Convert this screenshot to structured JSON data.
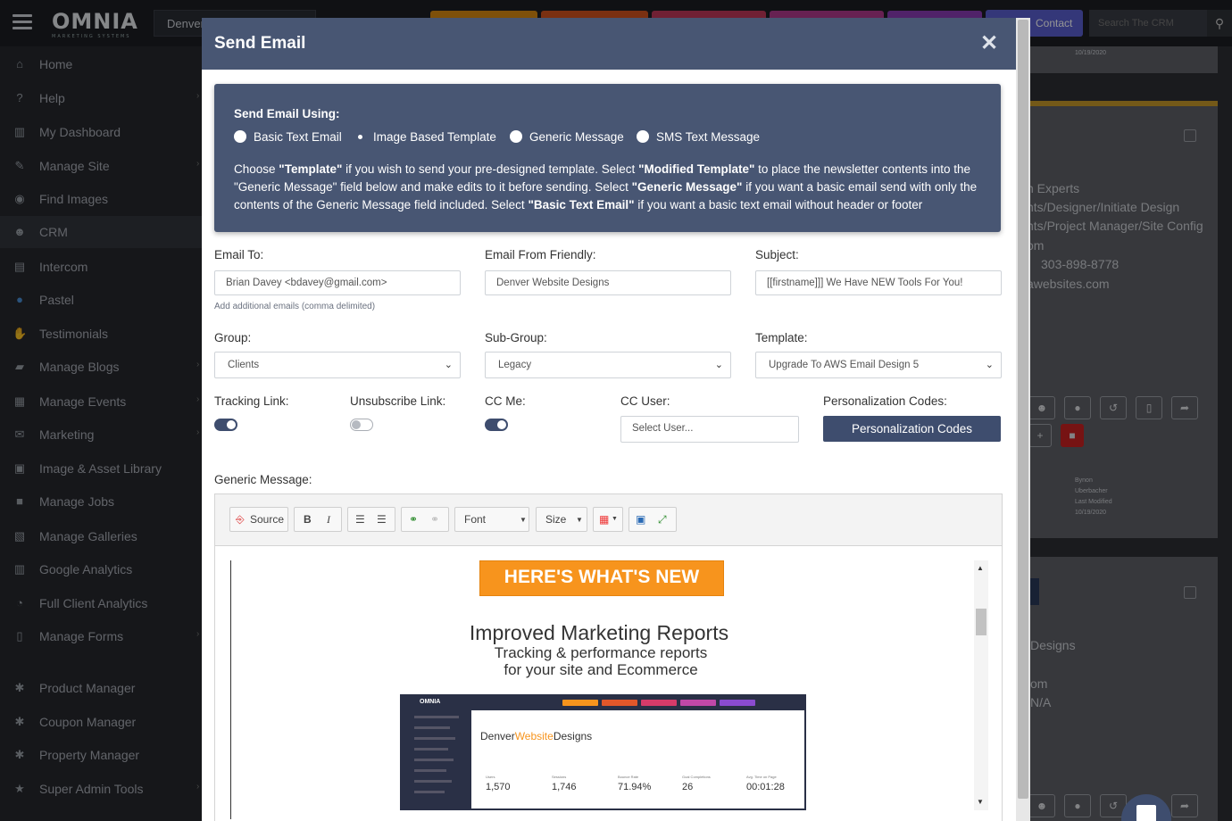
{
  "app": {
    "logo": "OMNIA",
    "logo_sub": "MARKETING SYSTEMS",
    "site_selector": "Denver",
    "contact_label": "Contact",
    "search_placeholder": "Search The CRM"
  },
  "sidebar": {
    "items": [
      {
        "label": "Home",
        "icon": "home-icon"
      },
      {
        "label": "Help",
        "icon": "question-icon"
      },
      {
        "label": "My Dashboard",
        "icon": "bar-chart-icon"
      },
      {
        "label": "Manage Site",
        "icon": "wrench-icon"
      },
      {
        "label": "Find Images",
        "icon": "camera-icon"
      },
      {
        "label": "CRM",
        "icon": "users-icon"
      },
      {
        "label": "Intercom",
        "icon": "chat-icon"
      },
      {
        "label": "Pastel",
        "icon": "brush-icon"
      },
      {
        "label": "Testimonials",
        "icon": "handshake-icon"
      },
      {
        "label": "Manage Blogs",
        "icon": "comments-icon"
      },
      {
        "label": "Manage Events",
        "icon": "calendar-icon"
      },
      {
        "label": "Marketing",
        "icon": "envelope-icon"
      },
      {
        "label": "Image & Asset Library",
        "icon": "image-icon"
      },
      {
        "label": "Manage Jobs",
        "icon": "briefcase-icon"
      },
      {
        "label": "Manage Galleries",
        "icon": "gallery-icon"
      },
      {
        "label": "Google Analytics",
        "icon": "chart-icon"
      },
      {
        "label": "Full Client Analytics",
        "icon": "pie-icon"
      },
      {
        "label": "Manage Forms",
        "icon": "file-icon"
      },
      {
        "label": "Product Manager",
        "icon": "cog-icon"
      },
      {
        "label": "Coupon Manager",
        "icon": "cog-icon"
      },
      {
        "label": "Property Manager",
        "icon": "cog-icon"
      },
      {
        "label": "Super Admin Tools",
        "icon": "star-icon"
      }
    ]
  },
  "background": {
    "date1": "10/19/2020",
    "lines": [
      "n Experts",
      "nts/Designer/Initiate Design",
      "nts/Project Manager/Site Config",
      "om",
      "303-898-8778",
      "awebsites.com"
    ],
    "meta": [
      "Bynon",
      "Uberbacher",
      "Last Modified",
      "10/19/2020"
    ],
    "lines2": [
      "Designs",
      "om",
      "N/A"
    ]
  },
  "modal": {
    "title": "Send Email",
    "send_using_label": "Send Email Using:",
    "options": [
      "Basic Text Email",
      "Image Based Template",
      "Generic Message",
      "SMS Text Message"
    ],
    "selected_option": "Image Based Template",
    "para": {
      "p1": "Choose ",
      "b1": "\"Template\"",
      "p2": " if you wish to send your pre-designed template. Select ",
      "b2": "\"Modified Template\"",
      "p3": " to place the newsletter contents into the \"Generic Message\" field below and make edits to it before sending. Select ",
      "b3": "\"Generic Message\"",
      "p4": " if you want a basic email send with only the contents of the Generic Message field included. Select ",
      "b4": "\"Basic Text Email\"",
      "p5": " if you want a basic text email without header or footer"
    },
    "email_to": {
      "label": "Email To:",
      "value": "Brian Davey <bdavey@gmail.com>",
      "hint": "Add additional emails (comma delimited)"
    },
    "email_from": {
      "label": "Email From Friendly:",
      "value": "Denver Website Designs"
    },
    "subject": {
      "label": "Subject:",
      "value": "[[firstname]]] We Have NEW Tools For You!"
    },
    "group": {
      "label": "Group:",
      "value": "Clients"
    },
    "subgroup": {
      "label": "Sub-Group:",
      "value": "Legacy"
    },
    "template": {
      "label": "Template:",
      "value": "Upgrade To AWS Email Design 5"
    },
    "tracking": {
      "label": "Tracking Link:",
      "on": true
    },
    "unsubscribe": {
      "label": "Unsubscribe Link:",
      "on": false
    },
    "ccme": {
      "label": "CC Me:",
      "on": true
    },
    "ccuser": {
      "label": "CC User:",
      "placeholder": "Select User..."
    },
    "pcodes": {
      "label": "Personalization Codes:",
      "button": "Personalization Codes"
    },
    "generic_label": "Generic Message:",
    "toolbar": {
      "source": "Source",
      "bold": "B",
      "italic": "I",
      "font": "Font",
      "size": "Size"
    },
    "content": {
      "banner": "HERE'S WHAT'S NEW",
      "headline": "Improved Marketing Reports",
      "sub1": "Tracking & performance reports",
      "sub2": "for your site and Ecommerce",
      "shot": {
        "logo": "OMNIA",
        "brand_a": "Denver",
        "brand_b": "Website",
        "brand_c": "Designs",
        "stats": [
          "1,570",
          "1,746",
          "71.94%",
          "26",
          "00:01:28"
        ],
        "stat_labels": [
          "Users",
          "Sessions",
          "Bounce Rate",
          "Goal Completions",
          "Avg. Time on Page"
        ]
      }
    }
  }
}
